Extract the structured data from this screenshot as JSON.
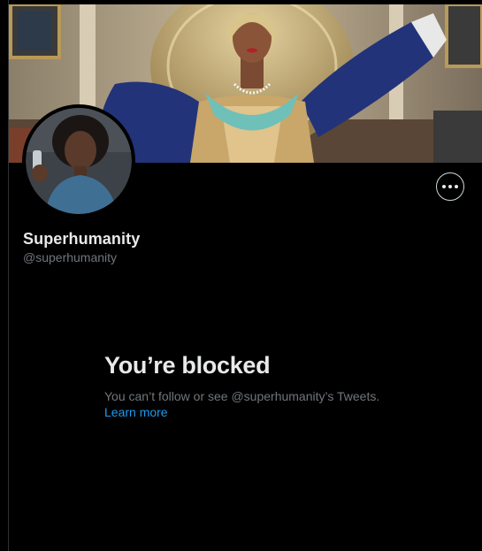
{
  "profile": {
    "display_name": "Superhumanity",
    "handle": "@superhumanity"
  },
  "actions": {
    "more_icon": "more-horizontal-icon"
  },
  "blocked": {
    "title": "You’re blocked",
    "description": "You can’t follow or see @superhumanity’s Tweets.",
    "learn_more": "Learn more"
  },
  "colors": {
    "background": "#000000",
    "primary_text": "#e7e9ea",
    "secondary_text": "#71767b",
    "link": "#1d9bf0"
  }
}
